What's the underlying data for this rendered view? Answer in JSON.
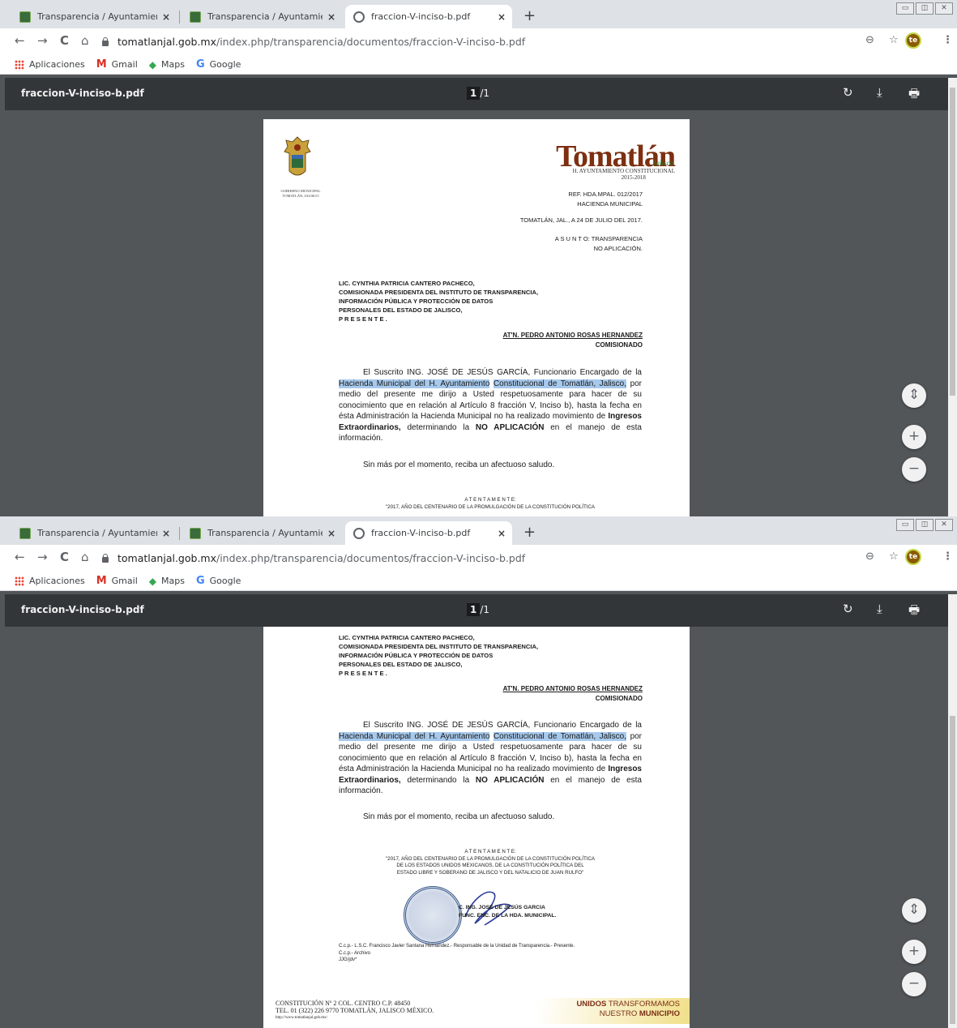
{
  "tabs": [
    {
      "title": "Transparencia / Ayuntamiento de",
      "close": "×"
    },
    {
      "title": "Transparencia / Ayuntamiento de",
      "close": "×"
    },
    {
      "title": "fraccion-V-inciso-b.pdf",
      "close": "×"
    }
  ],
  "new_tab": "+",
  "nav": {
    "back": "←",
    "forward": "→",
    "reload": "C",
    "home": "⌂"
  },
  "url": {
    "host": "tomatlanjal.gob.mx",
    "path": "/index.php/transparencia/documentos/fraccion-V-inciso-b.pdf"
  },
  "toolbar_icons": {
    "zoom": "search-icon",
    "star": "star-icon",
    "menu": "⋮",
    "profile": "te"
  },
  "bookmarks": [
    {
      "label": "Aplicaciones",
      "icon": "apps-icon"
    },
    {
      "label": "Gmail",
      "icon": "gmail-icon",
      "glyph": "M"
    },
    {
      "label": "Maps",
      "icon": "maps-icon",
      "glyph": "◆"
    },
    {
      "label": "Google",
      "icon": "google-icon",
      "glyph": "G"
    }
  ],
  "pdf": {
    "filename": "fraccion-V-inciso-b.pdf",
    "page_indicator_current": "1",
    "page_indicator_total": "/1",
    "rotate": "↻",
    "download": "⤓",
    "print": "🖶"
  },
  "zoom_buttons": {
    "fit": "⇕",
    "zoom_in": "+",
    "zoom_out": "−"
  },
  "document": {
    "logo_title": "Tomatlán",
    "logo_script": "Jalisco",
    "logo_sub": "H. AYUNTAMIENTO CONSTITUCIONAL",
    "logo_years": "2015-2018",
    "crest_caption_1": "GOBIERNO MUNICIPAL",
    "crest_caption_2": "TOMATLÁN, JALISCO",
    "ref": "REF. HDA.MPAL. 012/2017",
    "dept": "HACIENDA MUNICIPAL",
    "date": "TOMATLÁN, JAL., A 24 DE JULIO DEL 2017.",
    "asunto_1": "A S U N T O:  TRANSPARENCIA",
    "asunto_2": "NO APLICACIÓN.",
    "addr_1": "LIC. CYNTHIA PATRICIA CANTERO PACHECO,",
    "addr_2": "COMISIONADA PRESIDENTA DEL INSTITUTO DE TRANSPARENCIA,",
    "addr_3": "INFORMACIÓN PÚBLICA Y PROTECCIÓN DE DATOS",
    "addr_4": "PERSONALES  DEL ESTADO DE JALISCO,",
    "addr_5": "P R E S E N T E .",
    "attn": "AT'N. PEDRO ANTONIO ROSAS HERNANDEZ",
    "attn_role": "COMISIONADO",
    "body_1": "El Suscrito ING. JOSÉ DE JESÚS GARCÍA, Funcionario Encargado de la",
    "body_hl_1": "Hacienda Municipal del H. Ayuntamiento",
    "body_hl_2": "Constitucional de Tomatlán, Jalisco,",
    "body_2": "por medio del presente me dirijo a Usted respetuosamente para hacer de su conocimiento que en relación al Artículo 8 fracción V, Inciso b), hasta la fecha en ésta Administración la Hacienda Municipal no ha realizado movimiento de",
    "body_bold_1": "Ingresos Extraordinarios,",
    "body_3": " determinando la ",
    "body_bold_2": "NO APLICACIÓN",
    "body_4": " en el manejo de esta información.",
    "closing": "Sin más por el momento, reciba un afectuoso saludo.",
    "atte_1": "A T E N T A M E N T E:",
    "atte_2": "\"2017, AÑO DEL CENTENARIO DE LA PROMULGACIÓN DE LA CONSTITUCIÓN POLÍTICA",
    "atte_3": "DE LOS ESTADOS UNIDOS MEXICANOS, DE LA CONSTITUCIÓN POLÍTICA DEL",
    "atte_4": "ESTADO LIBRE Y SOBERANO DE JALISCO Y DEL NATALICIO DE JUAN RULFO\"",
    "sign_1": "C. ING. JOSÉ DE JESÚS GARCIA",
    "sign_2": "FUNC. ENC. DE LA HDA. MUNICIPAL.",
    "ccp_1": "C.c.p.- L.S.C. Francisco Javier Santana Hernández.- Responsable de la Unidad de Transparencia.- Presente.",
    "ccp_2": "C.c.p.- Archivo",
    "ccp_3": "JJG/jdv*",
    "foot_1": "CONSTITUCIÓN Nº 2 COL. CENTRO C.P. 48450",
    "foot_2": "TEL. 01 (322) 226 9770 TOMATLÁN, JALISCO MÉXICO.",
    "foot_3": "http://www.tomatlanjal.gob.mx/",
    "slogan_1a": "UNIDOS",
    "slogan_1b": " TRANSFORMAMOS",
    "slogan_2a": "NUESTRO ",
    "slogan_2b": "MUNICIPIO"
  }
}
